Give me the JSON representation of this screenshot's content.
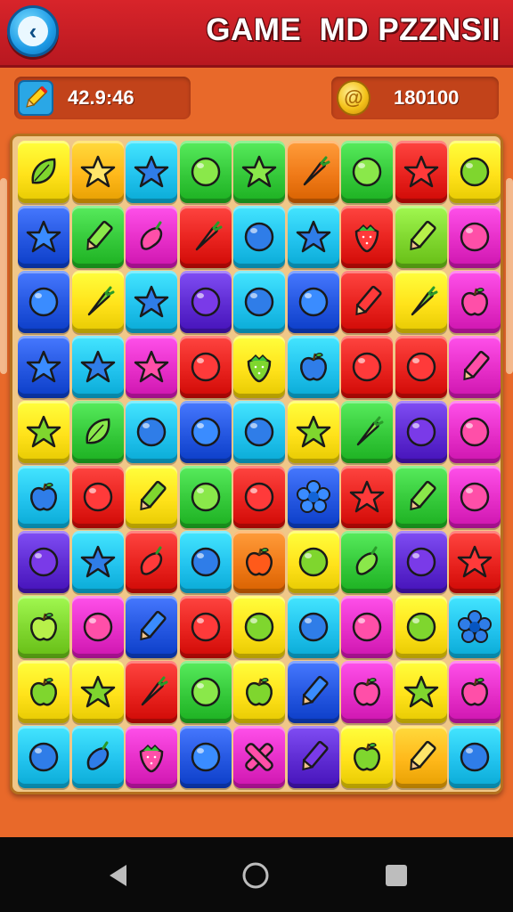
{
  "header": {
    "title": "GAME  MD PZZNSII",
    "back_icon": "back-arrow-icon"
  },
  "hud": {
    "left_icon": "pencil-icon",
    "left_value": "42.9:46",
    "right_icon": "coin-icon",
    "right_value": "180100"
  },
  "colors": {
    "y": "#ffe21a",
    "o": "#ffb81a",
    "c": "#22c3ee",
    "g": "#35c93a",
    "r": "#e8221e",
    "p": "#e62ec8",
    "b": "#2456e0",
    "v": "#5e2bd2",
    "or": "#f07a18",
    "lg": "#7fd62e"
  },
  "board": {
    "rows": [
      [
        [
          "y",
          "leaf"
        ],
        [
          "o",
          "star"
        ],
        [
          "c",
          "star"
        ],
        [
          "g",
          "circle"
        ],
        [
          "g",
          "star"
        ],
        [
          "or",
          "carrot"
        ],
        [
          "g",
          "circle"
        ],
        [
          "r",
          "star"
        ],
        [
          "y",
          "circle"
        ]
      ],
      [
        [
          "b",
          "star"
        ],
        [
          "g",
          "pencil"
        ],
        [
          "p",
          "pepper"
        ],
        [
          "r",
          "carrot"
        ],
        [
          "c",
          "circle"
        ],
        [
          "c",
          "star"
        ],
        [
          "r",
          "strawberry"
        ],
        [
          "lg",
          "pencil"
        ],
        [
          "p",
          "circle"
        ]
      ],
      [
        [
          "b",
          "circle"
        ],
        [
          "y",
          "carrot"
        ],
        [
          "c",
          "star"
        ],
        [
          "v",
          "circle"
        ],
        [
          "c",
          "circle"
        ],
        [
          "b",
          "circle"
        ],
        [
          "r",
          "pencil"
        ],
        [
          "y",
          "carrot"
        ],
        [
          "p",
          "apple"
        ]
      ],
      [
        [
          "b",
          "star"
        ],
        [
          "c",
          "star"
        ],
        [
          "p",
          "star"
        ],
        [
          "r",
          "circle"
        ],
        [
          "y",
          "strawberry"
        ],
        [
          "c",
          "apple"
        ],
        [
          "r",
          "circle"
        ],
        [
          "r",
          "circle"
        ],
        [
          "p",
          "pencil"
        ]
      ],
      [
        [
          "y",
          "star"
        ],
        [
          "g",
          "leaf"
        ],
        [
          "c",
          "circle"
        ],
        [
          "b",
          "circle"
        ],
        [
          "c",
          "circle"
        ],
        [
          "y",
          "star"
        ],
        [
          "g",
          "carrot"
        ],
        [
          "v",
          "circle"
        ],
        [
          "p",
          "circle"
        ]
      ],
      [
        [
          "c",
          "apple"
        ],
        [
          "r",
          "circle"
        ],
        [
          "y",
          "pencil"
        ],
        [
          "g",
          "circle"
        ],
        [
          "r",
          "circle"
        ],
        [
          "b",
          "flower"
        ],
        [
          "r",
          "star"
        ],
        [
          "g",
          "pencil"
        ],
        [
          "p",
          "circle"
        ]
      ],
      [
        [
          "v",
          "circle"
        ],
        [
          "c",
          "star"
        ],
        [
          "r",
          "pepper"
        ],
        [
          "c",
          "circle"
        ],
        [
          "or",
          "apple"
        ],
        [
          "y",
          "circle"
        ],
        [
          "g",
          "pepper"
        ],
        [
          "v",
          "circle"
        ],
        [
          "r",
          "star"
        ]
      ],
      [
        [
          "lg",
          "apple"
        ],
        [
          "p",
          "circle"
        ],
        [
          "b",
          "pencil"
        ],
        [
          "r",
          "circle"
        ],
        [
          "y",
          "circle"
        ],
        [
          "c",
          "circle"
        ],
        [
          "p",
          "circle"
        ],
        [
          "y",
          "circle"
        ],
        [
          "c",
          "flower"
        ]
      ],
      [
        [
          "y",
          "apple"
        ],
        [
          "y",
          "star"
        ],
        [
          "r",
          "carrot"
        ],
        [
          "g",
          "circle"
        ],
        [
          "y",
          "apple"
        ],
        [
          "b",
          "pencil"
        ],
        [
          "p",
          "apple"
        ],
        [
          "y",
          "star"
        ],
        [
          "p",
          "apple"
        ]
      ],
      [
        [
          "c",
          "circle"
        ],
        [
          "c",
          "pepper"
        ],
        [
          "p",
          "strawberry"
        ],
        [
          "b",
          "circle"
        ],
        [
          "p",
          "cross"
        ],
        [
          "v",
          "pencil"
        ],
        [
          "y",
          "apple"
        ],
        [
          "o",
          "pencil"
        ],
        [
          "c",
          "circle"
        ]
      ]
    ]
  },
  "nav": {
    "back_icon": "nav-back-icon",
    "home_icon": "nav-home-icon",
    "recent_icon": "nav-recents-icon"
  }
}
